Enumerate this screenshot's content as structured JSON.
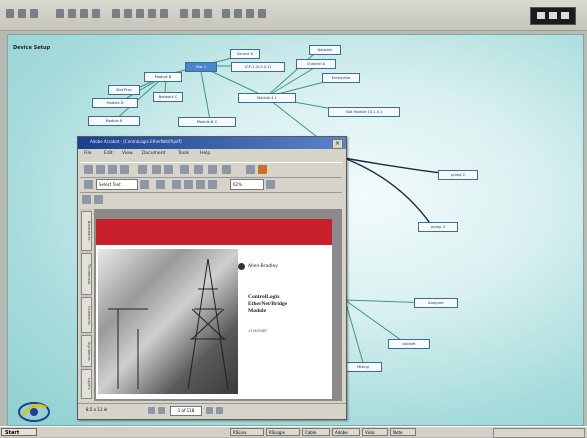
{
  "canvas": {
    "title": "Device Setup"
  },
  "nodes": [
    {
      "label": "Slot 1",
      "selected": true
    },
    {
      "label": "Source A"
    },
    {
      "label": "ICP-1 (0.0.0.1)"
    },
    {
      "label": "Network"
    },
    {
      "label": "Channel A"
    },
    {
      "label": "Enterprise"
    },
    {
      "label": "Module B"
    },
    {
      "label": "Slot Proc"
    },
    {
      "label": "Network C"
    },
    {
      "label": "Module D"
    },
    {
      "label": "Module R"
    },
    {
      "label": "Module B C"
    },
    {
      "label": "Module 4 1"
    },
    {
      "label": "Slot Module 10.1.0.1"
    },
    {
      "label": "pump 2"
    },
    {
      "label": "pump 3"
    },
    {
      "label": "Analyzer"
    },
    {
      "label": "cabinet"
    },
    {
      "label": "Mixing"
    }
  ],
  "window": {
    "title": "Adobe Acrobat - [CentroLogix EtherNet/IP.pdf]",
    "menu": [
      "File",
      "Edit",
      "View",
      "Document",
      "Tools",
      "Help"
    ],
    "select_text": "Select Text",
    "zoom": "62%",
    "side_tabs": [
      "Bookmarks",
      "Thumbnails",
      "Comments",
      "Signatures",
      "Layers"
    ],
    "doc": {
      "brand": "Allen-Bradley",
      "title_lines": [
        "ControlLogix",
        "EtherNet/Bridge",
        "Module"
      ],
      "subtitle": "1756-ENBT"
    },
    "page_indicator": "1 of 118",
    "page_size": "8.5 x 11 in"
  },
  "taskbar": {
    "start": "Start",
    "tasks": [
      "RSLinx",
      "RSLogix",
      "Cable",
      "Adobe",
      "Visio",
      "Note"
    ]
  }
}
